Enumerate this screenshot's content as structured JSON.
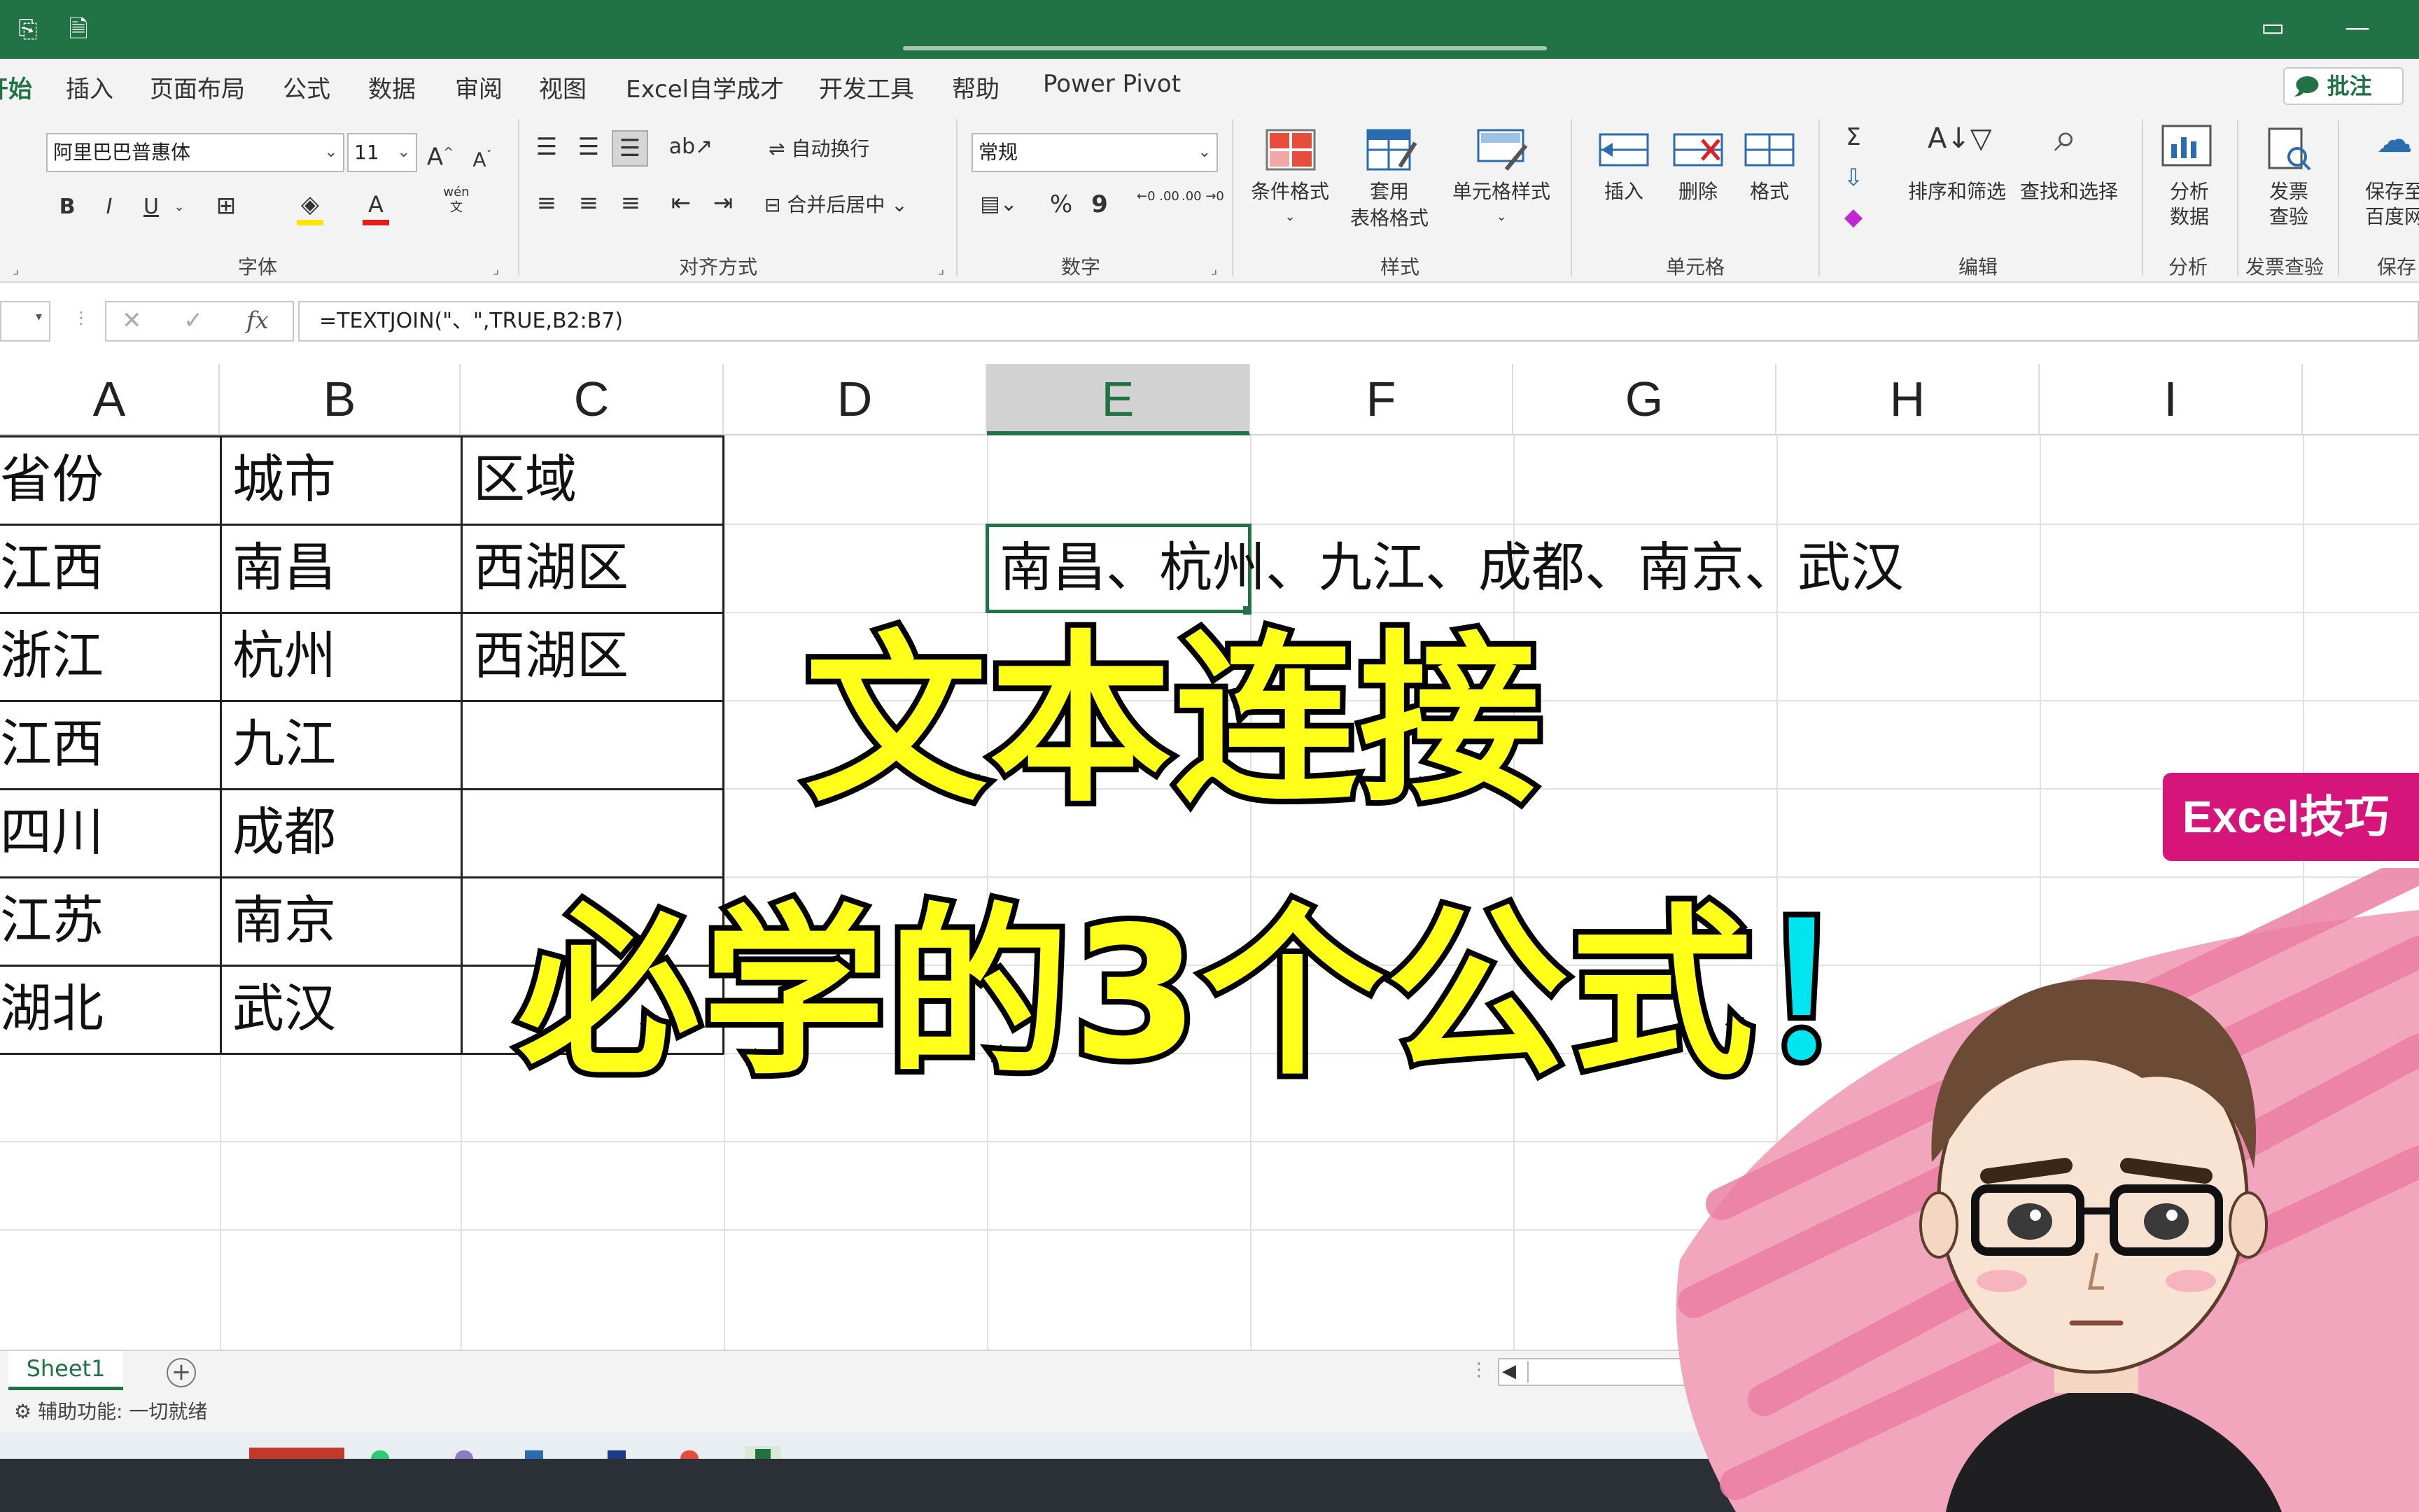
{
  "menu": {
    "tabs": [
      "开始",
      "插入",
      "页面布局",
      "公式",
      "数据",
      "审阅",
      "视图",
      "Excel自学成才",
      "开发工具",
      "帮助",
      "Power Pivot"
    ],
    "comment_button": "批注"
  },
  "ribbon": {
    "font": {
      "name": "阿里巴巴普惠体",
      "size": "11",
      "increase": "A",
      "decrease": "A",
      "bold": "B",
      "italic": "I",
      "underline": "U",
      "font_color": "A",
      "wen": "wén"
    },
    "alignment": {
      "wrap_text": "自动换行",
      "merge_center": "合并后居中"
    },
    "number": {
      "format": "常规",
      "percent": "%",
      "comma": "9",
      "inc_dec": "←0 .00",
      "dec_dec": ".00 →0"
    },
    "styles": {
      "conditional": "条件格式",
      "table_format_1": "套用",
      "table_format_2": "表格格式",
      "cell_styles": "单元格样式"
    },
    "cells": {
      "insert": "插入",
      "delete": "删除",
      "format": "格式"
    },
    "editing": {
      "sigma": "Σ",
      "sort_filter": "排序和筛选",
      "find_select": "查找和选择"
    },
    "analysis": {
      "analyze_1": "分析",
      "analyze_2": "数据"
    },
    "invoice": {
      "check_1": "发票",
      "check_2": "查验"
    },
    "save": {
      "save_1": "保存至",
      "save_2": "百度网"
    },
    "groups": [
      "字体",
      "对齐方式",
      "数字",
      "样式",
      "单元格",
      "编辑",
      "分析",
      "发票查验",
      "保存"
    ]
  },
  "formula_bar": {
    "formula": "=TEXTJOIN(\"、\",TRUE,B2:B7)",
    "cancel": "✕",
    "enter": "✓",
    "fx": "fx"
  },
  "sheet": {
    "columns": [
      "A",
      "B",
      "C",
      "D",
      "E",
      "F",
      "G",
      "H",
      "I"
    ],
    "selected_column": "E",
    "rows": [
      [
        "省份",
        "城市",
        "区域"
      ],
      [
        "江西",
        "南昌",
        "西湖区"
      ],
      [
        "浙江",
        "杭州",
        "西湖区"
      ],
      [
        "江西",
        "九江",
        ""
      ],
      [
        "四川",
        "成都",
        ""
      ],
      [
        "江苏",
        "南京",
        ""
      ],
      [
        "湖北",
        "武汉",
        ""
      ]
    ],
    "result_cell": "南昌、杭州、九江、成都、南京、武汉"
  },
  "sheet_tabs": {
    "active": "Sheet1",
    "add": "+"
  },
  "status": {
    "accessibility": "辅助功能: 一切就绪"
  },
  "overlay": {
    "line1": "文本连接",
    "line2_main": "必学的3个公式",
    "line2_mark": "！",
    "badge": "Excel技巧"
  },
  "colors": {
    "excel_green": "#217346",
    "title_yellow": "#ffff1a",
    "badge_pink": "#d6157a",
    "exclaim_cyan": "#00e6f0"
  }
}
